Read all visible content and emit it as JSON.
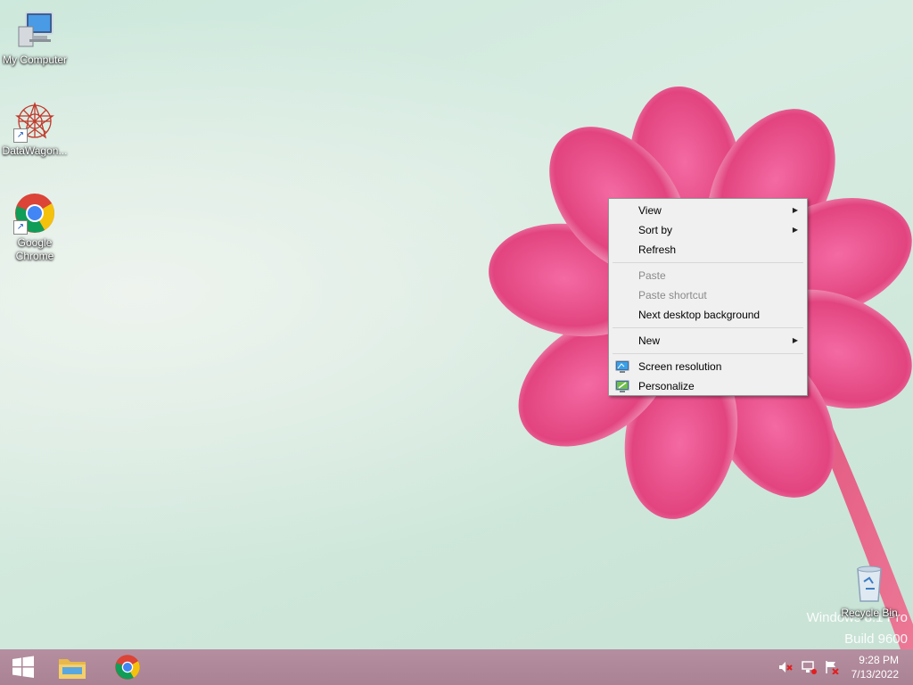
{
  "desktop": {
    "icons": [
      {
        "label": "My Computer",
        "icon": "computer-icon"
      },
      {
        "label": "DataWagon...",
        "icon": "datawagon-icon"
      },
      {
        "label": "Google Chrome",
        "icon": "chrome-icon"
      },
      {
        "label": "Recycle Bin",
        "icon": "recycle-bin-icon"
      }
    ],
    "watermark": {
      "line1": "Windows 8.1 Pro",
      "line2": "Build 9600"
    }
  },
  "context_menu": {
    "items": [
      {
        "label": "View",
        "has_submenu": true,
        "enabled": true
      },
      {
        "label": "Sort by",
        "has_submenu": true,
        "enabled": true
      },
      {
        "label": "Refresh",
        "enabled": true
      },
      {
        "label": "Paste",
        "enabled": false
      },
      {
        "label": "Paste shortcut",
        "enabled": false
      },
      {
        "label": "Next desktop background",
        "enabled": true
      },
      {
        "label": "New",
        "has_submenu": true,
        "enabled": true
      },
      {
        "label": "Screen resolution",
        "icon": "screen-resolution-icon",
        "enabled": true
      },
      {
        "label": "Personalize",
        "icon": "personalize-icon",
        "enabled": true
      }
    ]
  },
  "taskbar": {
    "buttons": [
      {
        "name": "start",
        "icon": "windows-logo-icon"
      },
      {
        "name": "file-explorer",
        "icon": "folder-icon"
      },
      {
        "name": "chrome",
        "icon": "chrome-icon"
      }
    ],
    "tray": {
      "icons": [
        "volume-muted-icon",
        "network-icon",
        "action-center-flag-icon"
      ],
      "time": "9:28 PM",
      "date": "7/13/2022"
    }
  },
  "colors": {
    "desktop_bg": "#cfe7db",
    "flower_pink": "#e0457f",
    "taskbar": "#ad8697",
    "menu_bg": "#f0f0f0"
  }
}
